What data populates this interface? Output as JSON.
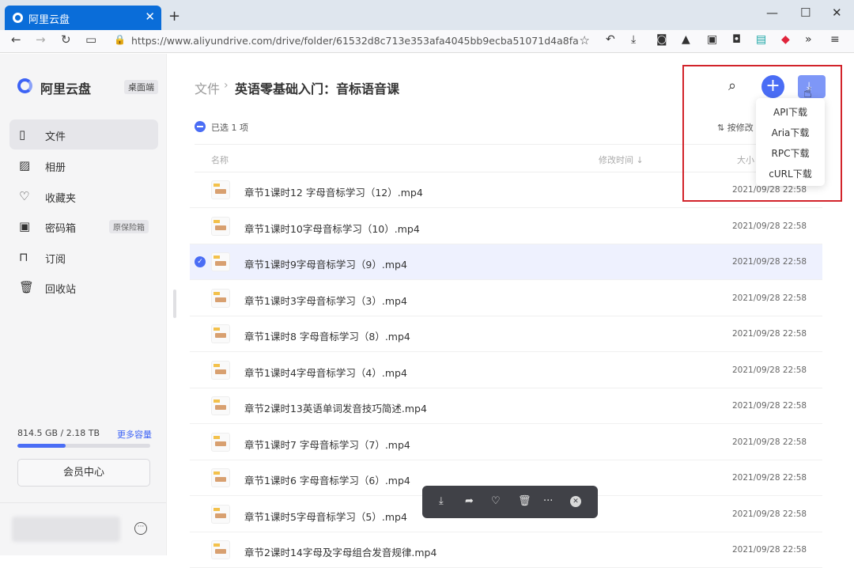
{
  "browser": {
    "tab_title": "阿里云盘",
    "tab_close": "✕",
    "new_tab": "+",
    "url": "https://www.aliyundrive.com/drive/folder/61532d8c713e353afa4045bb9ecba51071d4a8fa",
    "win_minimize": "—",
    "win_maximize": "☐",
    "win_close": "✕"
  },
  "sidebar": {
    "logo_text": "阿里云盘",
    "desktop_label": "桌面端",
    "items": [
      {
        "label": "文件",
        "icon": "file-icon"
      },
      {
        "label": "相册",
        "icon": "photo-icon"
      },
      {
        "label": "收藏夹",
        "icon": "heart-icon"
      },
      {
        "label": "密码箱",
        "icon": "safe-icon",
        "badge": "原保险箱"
      },
      {
        "label": "订阅",
        "icon": "bookmark-icon"
      },
      {
        "label": "回收站",
        "icon": "trash-icon"
      }
    ],
    "storage_text": "814.5 GB / 2.18 TB",
    "storage_fraction": 0.365,
    "more_capacity": "更多容量",
    "member_center": "会员中心"
  },
  "main": {
    "breadcrumb_root": "文件",
    "breadcrumb_sep": "›",
    "breadcrumb_current": "英语零基础入门：音标语音课",
    "selected_text": "已选 1 项",
    "sort_label": "⇅ 按修改",
    "col_name": "名称",
    "col_time": "修改时间 ↓",
    "col_size": "大小",
    "files": [
      {
        "name": "章节1课时12 字母音标学习（12）.mp4",
        "time": "2021/09/28 22:58",
        "selected": false
      },
      {
        "name": "章节1课时10字母音标学习（10）.mp4",
        "time": "2021/09/28 22:58",
        "selected": false
      },
      {
        "name": "章节1课时9字母音标学习（9）.mp4",
        "time": "2021/09/28 22:58",
        "selected": true
      },
      {
        "name": "章节1课时3字母音标学习（3）.mp4",
        "time": "2021/09/28 22:58",
        "selected": false
      },
      {
        "name": "章节1课时8 字母音标学习（8）.mp4",
        "time": "2021/09/28 22:58",
        "selected": false
      },
      {
        "name": "章节1课时4字母音标学习（4）.mp4",
        "time": "2021/09/28 22:58",
        "selected": false
      },
      {
        "name": "章节2课时13英语单词发音技巧简述.mp4",
        "time": "2021/09/28 22:58",
        "selected": false
      },
      {
        "name": "章节1课时7 字母音标学习（7）.mp4",
        "time": "2021/09/28 22:58",
        "selected": false
      },
      {
        "name": "章节1课时6 字母音标学习（6）.mp4",
        "time": "2021/09/28 22:58",
        "selected": false
      },
      {
        "name": "章节1课时5字母音标学习（5）.mp4",
        "time": "2021/09/28 22:58",
        "selected": false
      },
      {
        "name": "章节2课时14字母及字母组合发音规律.mp4",
        "time": "2021/09/28 22:58",
        "selected": false
      }
    ]
  },
  "download_menu": {
    "items": [
      "API下载",
      "Aria下载",
      "RPC下载",
      "cURL下载"
    ]
  },
  "colors": {
    "accent": "#4a6df5",
    "highlight_box": "#d2232a",
    "tab_blue": "#0a6dd9"
  }
}
